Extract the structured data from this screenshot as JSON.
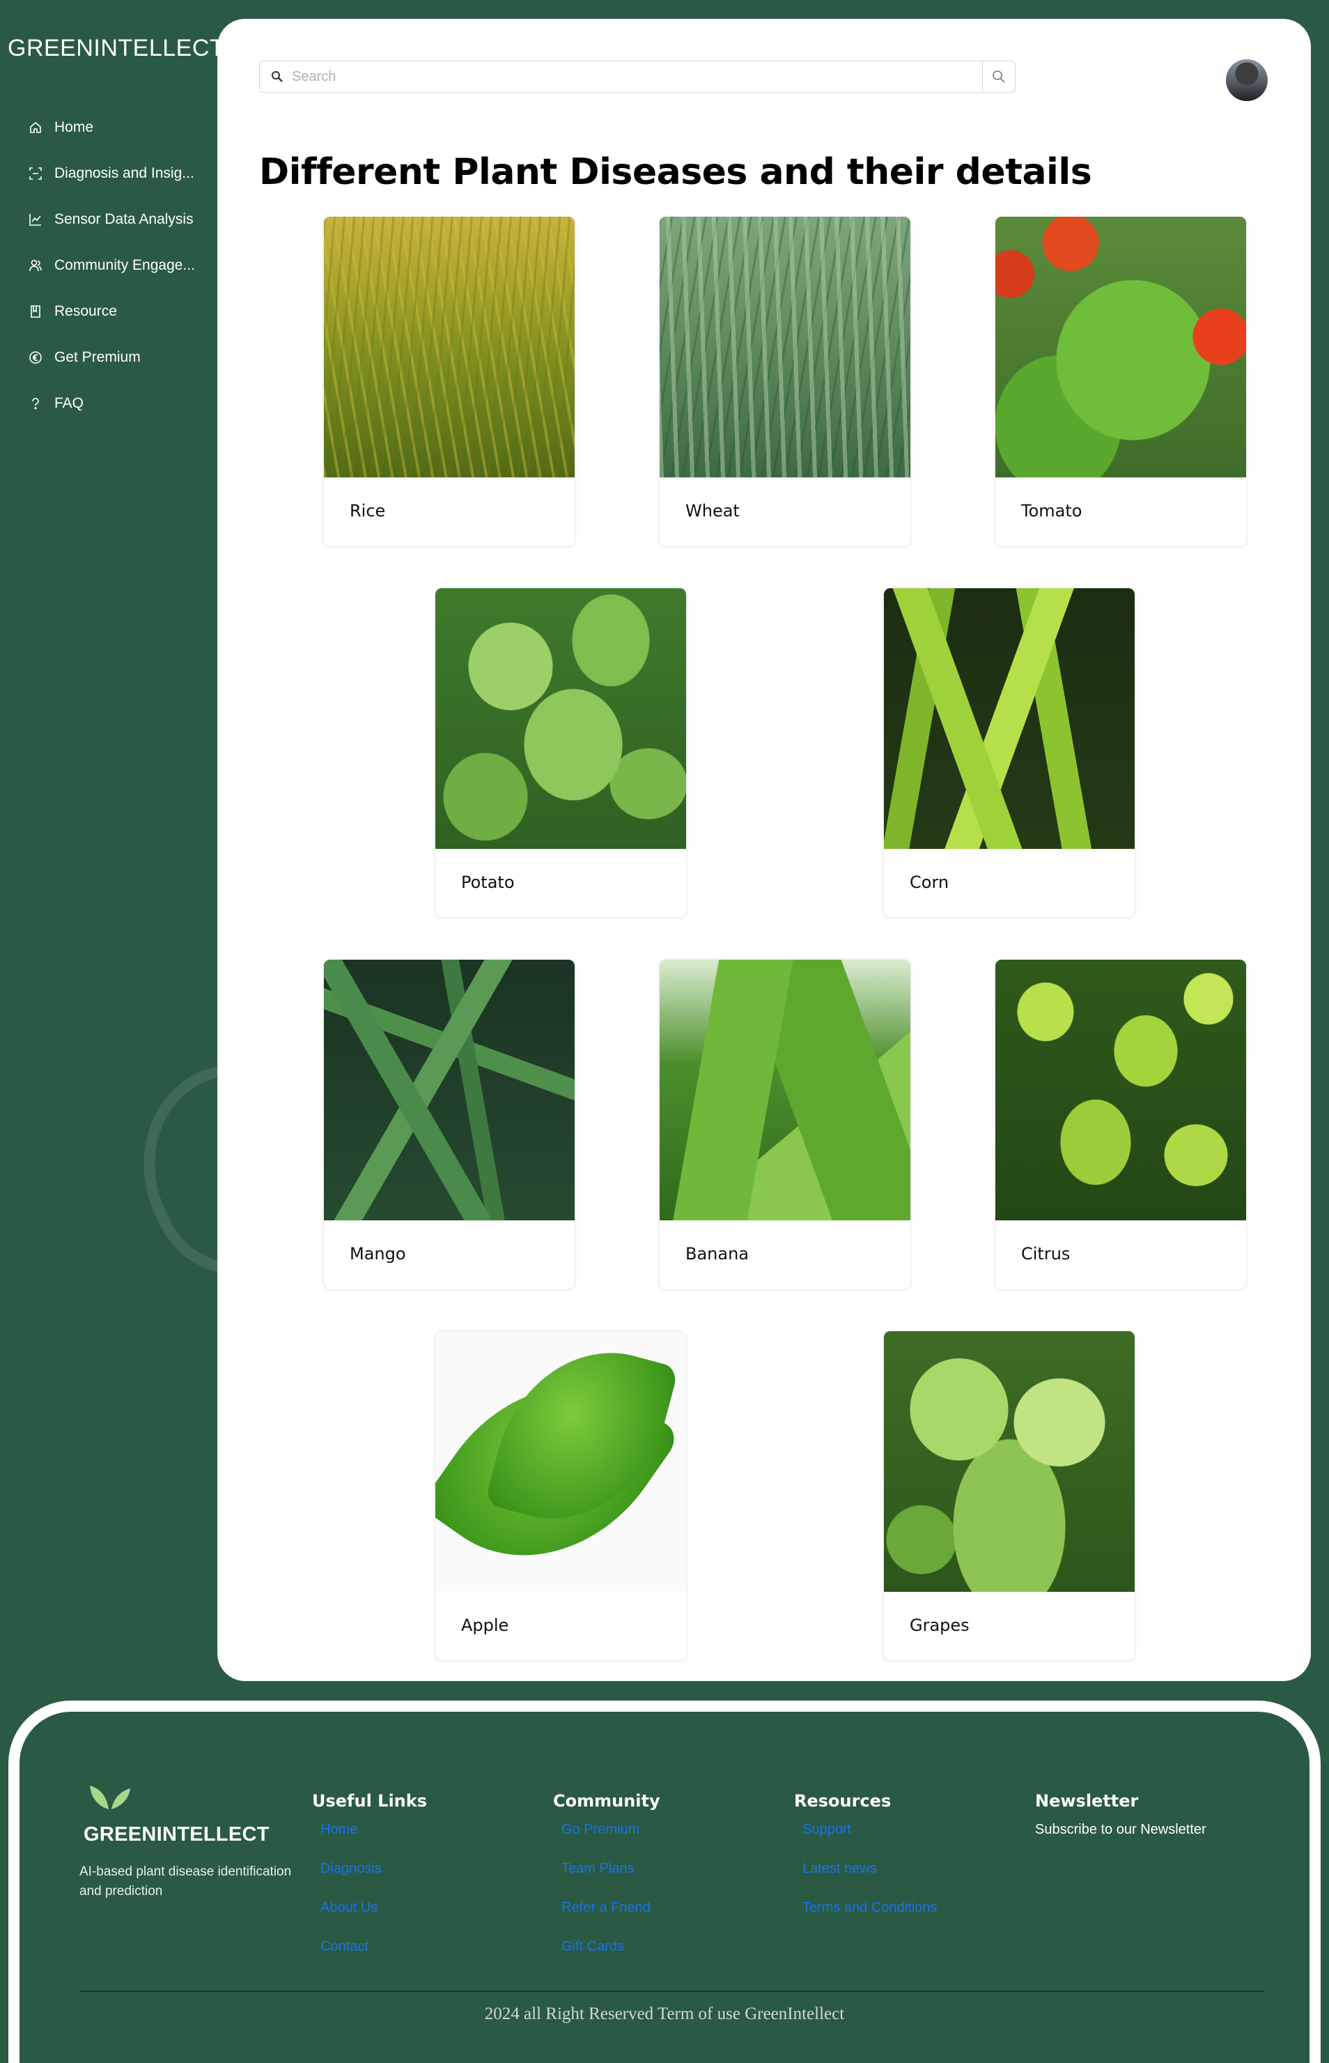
{
  "app": {
    "brand": "GREENINTELLECT"
  },
  "sidebar": {
    "items": [
      {
        "label": "Home",
        "icon": "home-icon"
      },
      {
        "label": "Diagnosis and Insig...",
        "icon": "scan-icon"
      },
      {
        "label": "Sensor Data Analysis",
        "icon": "chart-line-icon"
      },
      {
        "label": "Community Engage...",
        "icon": "users-icon"
      },
      {
        "label": "Resource",
        "icon": "book-icon"
      },
      {
        "label": "Get Premium",
        "icon": "euro-icon"
      },
      {
        "label": "FAQ",
        "icon": "question-icon"
      }
    ]
  },
  "header": {
    "search_placeholder": "Search"
  },
  "main": {
    "title": "Different Plant Diseases and their details",
    "plants": [
      {
        "name": "Rice"
      },
      {
        "name": "Wheat"
      },
      {
        "name": "Tomato"
      },
      {
        "name": "Potato"
      },
      {
        "name": "Corn"
      },
      {
        "name": "Mango"
      },
      {
        "name": "Banana"
      },
      {
        "name": "Citrus"
      },
      {
        "name": "Apple"
      },
      {
        "name": "Grapes"
      }
    ]
  },
  "footer": {
    "brand": "GREENINTELLECT",
    "tagline": "AI-based plant disease identification and prediction",
    "useful_links": {
      "title": "Useful Links",
      "links": [
        "Home",
        "Diagnosis",
        "About Us",
        "Contact"
      ]
    },
    "community": {
      "title": "Community",
      "links": [
        "Go Premium",
        "Team Plans",
        "Refer a Friend",
        "Gift Cards"
      ]
    },
    "resources": {
      "title": "Resources",
      "links": [
        "Support",
        "Latest news",
        "Terms and Conditions"
      ]
    },
    "newsletter": {
      "title": "Newsletter",
      "text": "Subscribe to our Newsletter"
    },
    "copyright": "2024 all Right Reserved Term of use GreenIntellect"
  },
  "colors": {
    "background": "#2a5a43",
    "panel": "#ffffff",
    "link": "#1a73e8"
  }
}
